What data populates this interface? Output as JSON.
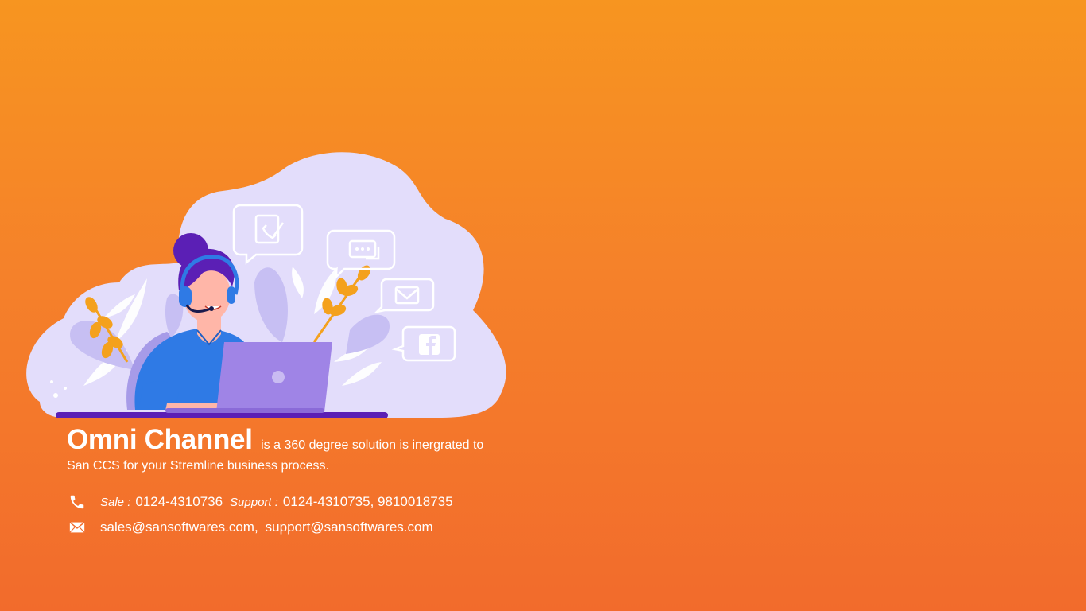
{
  "icons": {
    "phone": "phone-icon",
    "mail": "envelope-icon",
    "chat_channels": [
      "phone-note-icon",
      "chat-bubble-icon",
      "gmail-icon",
      "facebook-icon"
    ]
  },
  "colors": {
    "background_top": "#f79520",
    "background_bottom": "#f26b2c",
    "blob": "#e3ddfb",
    "agent_shirt": "#2f7ae5",
    "hair": "#5b1fb5",
    "laptop": "#9f84e6",
    "leaf_orange": "#f4a11d"
  },
  "hero": {
    "title": "Omni Channel",
    "tagline_line1": "is a 360 degree solution is inergrated to",
    "tagline_line2": "San CCS  for your Stremline business process."
  },
  "contact": {
    "sale_label": "Sale :",
    "sale_number": "0124-4310736",
    "support_label": "Support :",
    "support_numbers": "0124-4310735, 9810018735",
    "sales_email": "sales@sansoftwares.com,",
    "support_email": "support@sansoftwares.com"
  }
}
